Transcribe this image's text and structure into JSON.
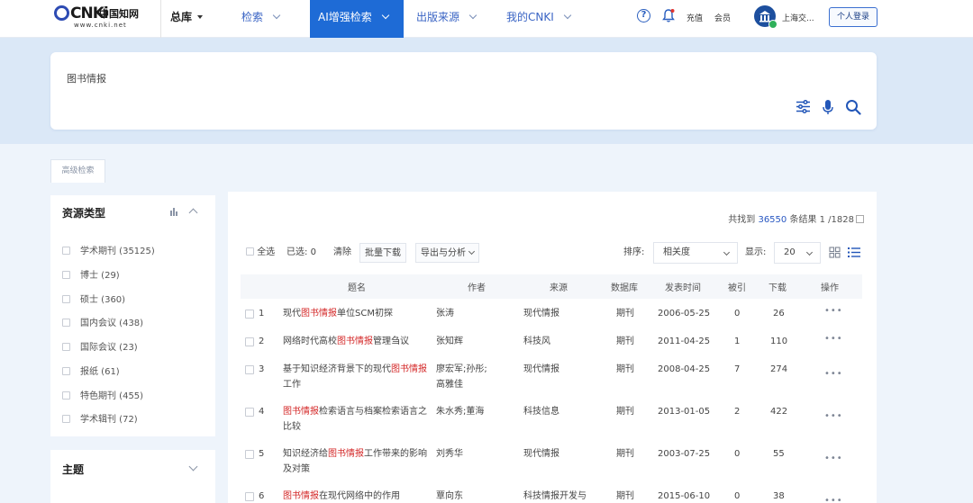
{
  "brand": {
    "mark": "CNKi",
    "cn_name": "中国知网",
    "url": "www.cnki.net"
  },
  "header": {
    "db_select": "总库",
    "nav": [
      {
        "label": "检索",
        "active": false
      },
      {
        "label": "AI增强检索",
        "active": true
      },
      {
        "label": "出版来源",
        "active": false
      },
      {
        "label": "我的CNKI",
        "active": false
      }
    ],
    "help_icon": "question-circle-icon",
    "bell_icon": "bell-icon",
    "recharge": "充值",
    "member": "会员",
    "org_name": "上海交...",
    "login_button": "个人登录"
  },
  "search": {
    "query": "图书情报",
    "icons": [
      "filter-sliders-icon",
      "microphone-icon",
      "search-icon"
    ]
  },
  "advanced_tab": "高级检索",
  "sidebar": {
    "resource_type": {
      "title": "资源类型",
      "items": [
        {
          "label": "学术期刊 (35125)",
          "checked": false
        },
        {
          "label": "博士 (29)",
          "checked": false
        },
        {
          "label": "硕士 (360)",
          "checked": false
        },
        {
          "label": "国内会议 (438)",
          "checked": false
        },
        {
          "label": "国际会议 (23)",
          "checked": false
        },
        {
          "label": "报纸 (61)",
          "checked": false
        },
        {
          "label": "特色期刊 (455)",
          "checked": false
        },
        {
          "label": "学术辑刊 (72)",
          "checked": false
        }
      ]
    },
    "topic": {
      "title": "主题"
    }
  },
  "results": {
    "count_prefix": "共找到",
    "count": "36550",
    "count_suffix": "条结果",
    "page": "1 /1828",
    "toolbar": {
      "select_all": "全选",
      "selected_label": "已选:",
      "selected_count": "0",
      "clear": "清除",
      "batch_download": "批量下载",
      "export": "导出与分析",
      "sort_label": "排序:",
      "sort_value": "相关度",
      "show_label": "显示:",
      "show_value": "20"
    },
    "columns": [
      "题名",
      "作者",
      "来源",
      "数据库",
      "发表时间",
      "被引",
      "下载",
      "操作"
    ],
    "rows": [
      {
        "no": "1",
        "title_before": "现代",
        "highlight": "图书情报",
        "title_after": "单位SCM初探",
        "authors": "张涛",
        "source": "现代情报",
        "database": "期刊",
        "date": "2006-05-25",
        "cited": "0",
        "downloads": "26",
        "ops": "•••"
      },
      {
        "no": "2",
        "title_before": "网络时代高校",
        "highlight": "图书情报",
        "title_after": "管理刍议",
        "authors": "张知辉",
        "source": "科技风",
        "database": "期刊",
        "date": "2011-04-25",
        "cited": "1",
        "downloads": "110",
        "ops": "•••"
      },
      {
        "no": "3",
        "title_before": "基于知识经济背景下的现代",
        "highlight": "图书情报",
        "title_after": "工作",
        "authors": "廖宏军;孙彤;高雅佳",
        "source": "现代情报",
        "database": "期刊",
        "date": "2008-04-25",
        "cited": "7",
        "downloads": "274",
        "ops": "•••"
      },
      {
        "no": "4",
        "title_before": "",
        "highlight": "图书情报",
        "title_after": "检索语言与档案检索语言之比较",
        "authors": "朱水秀;董海",
        "source": "科技信息",
        "database": "期刊",
        "date": "2013-01-05",
        "cited": "2",
        "downloads": "422",
        "ops": "•••"
      },
      {
        "no": "5",
        "title_before": "知识经济给",
        "highlight": "图书情报",
        "title_after": "工作带来的影响及对策",
        "authors": "刘秀华",
        "source": "现代情报",
        "database": "期刊",
        "date": "2003-07-25",
        "cited": "0",
        "downloads": "55",
        "ops": "•••"
      },
      {
        "no": "6",
        "title_before": "",
        "highlight": "图书情报",
        "title_after": "在现代网络中的作用",
        "authors": "覃向东",
        "source": "科技情报开发与",
        "database": "期刊",
        "date": "2015-06-10",
        "cited": "0",
        "downloads": "38",
        "ops": "•••"
      }
    ]
  }
}
